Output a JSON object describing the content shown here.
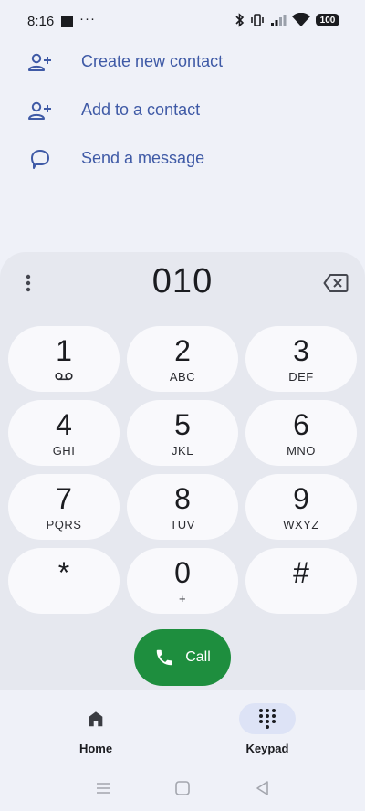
{
  "status_bar": {
    "time": "8:16",
    "overflow": "···",
    "battery": "100",
    "icons": [
      "bluetooth-icon",
      "vibrate-icon",
      "signal-icon",
      "wifi-icon"
    ]
  },
  "actions": [
    {
      "label": "Create new contact",
      "icon": "person-add-icon"
    },
    {
      "label": "Add to a contact",
      "icon": "person-add-icon"
    },
    {
      "label": "Send a message",
      "icon": "message-icon"
    }
  ],
  "dialer": {
    "number": "010",
    "keys": [
      {
        "digit": "1",
        "letters": ""
      },
      {
        "digit": "2",
        "letters": "ABC"
      },
      {
        "digit": "3",
        "letters": "DEF"
      },
      {
        "digit": "4",
        "letters": "GHI"
      },
      {
        "digit": "5",
        "letters": "JKL"
      },
      {
        "digit": "6",
        "letters": "MNO"
      },
      {
        "digit": "7",
        "letters": "PQRS"
      },
      {
        "digit": "8",
        "letters": "TUV"
      },
      {
        "digit": "9",
        "letters": "WXYZ"
      },
      {
        "digit": "*",
        "letters": ""
      },
      {
        "digit": "0",
        "letters": "+"
      },
      {
        "digit": "#",
        "letters": ""
      }
    ],
    "call_label": "Call"
  },
  "bottom_nav": {
    "home_label": "Home",
    "keypad_label": "Keypad"
  },
  "colors": {
    "accent_text": "#3f5aa6",
    "call_green": "#1e8e3e",
    "active_pill": "#dde3f6"
  }
}
